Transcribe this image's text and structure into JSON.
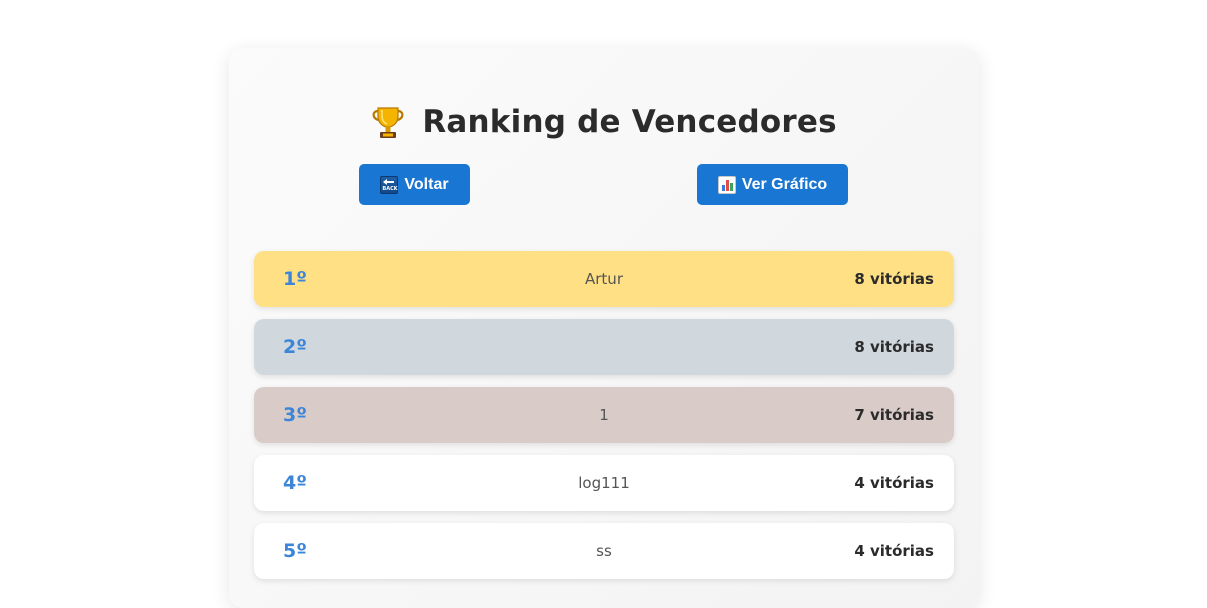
{
  "page": {
    "title": "Ranking de Vencedores",
    "title_icon": "trophy-icon"
  },
  "toolbar": {
    "back_label": "Voltar",
    "back_icon": "back-icon",
    "chart_label": "Ver Gráfico",
    "chart_icon": "bar-chart-icon",
    "button_color": "#1976d2"
  },
  "ranking": [
    {
      "position": "1º",
      "name": "Artur",
      "wins": "8 vitórias",
      "color": "#ffe084"
    },
    {
      "position": "2º",
      "name": "",
      "wins": "8 vitórias",
      "color": "#d0d8de"
    },
    {
      "position": "3º",
      "name": "1",
      "wins": "7 vitórias",
      "color": "#d9ccc8"
    },
    {
      "position": "4º",
      "name": "log111",
      "wins": "4 vitórias",
      "color": "#ffffff"
    },
    {
      "position": "5º",
      "name": "ss",
      "wins": "4 vitórias",
      "color": "#ffffff"
    }
  ]
}
